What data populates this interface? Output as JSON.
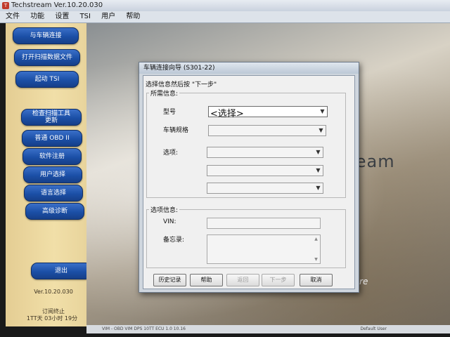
{
  "window": {
    "title": "Techstream Ver.10.20.030"
  },
  "menu": [
    "文件",
    "功能",
    "设置",
    "TSI",
    "用户",
    "帮助"
  ],
  "left_panel": {
    "buttons": [
      "与车辆连接",
      "打开扫描数据文件",
      "起动 TSI"
    ],
    "tools": [
      {
        "line1": "检查扫描工具",
        "line2": "更新"
      },
      {
        "label": "普通 OBD II"
      },
      {
        "label": "软件注册"
      },
      {
        "label": "用户选择"
      },
      {
        "label": "语言选择"
      },
      {
        "label": "高级诊断"
      }
    ],
    "exit_button": "退出",
    "version": "Ver.10.20.030",
    "subscription": "订阅终止",
    "remaining": "1TT天 03小时 19分"
  },
  "brand": {
    "text": "tream",
    "tagline": "ftware"
  },
  "statusbar": {
    "left": "VIM - OBD VIM DPS 10TT  ECU 1.0 10.16",
    "right": "Default User"
  },
  "dialog": {
    "title": "车辆连接向导 (S301-22)",
    "instruction": "选择信息然后按 \"下一步\"",
    "required_group": "所需信息:",
    "model_label": "型号",
    "model_value": "<选择>",
    "spec_label": "车辆规格",
    "options_label": "选项:",
    "option_info_group": "选项信息:",
    "vin_label": "VIN:",
    "memo_label": "备忘录:",
    "buttons": {
      "history": "历史记录",
      "help": "帮助",
      "back": "返回",
      "next": "下一步",
      "cancel": "取消"
    }
  }
}
